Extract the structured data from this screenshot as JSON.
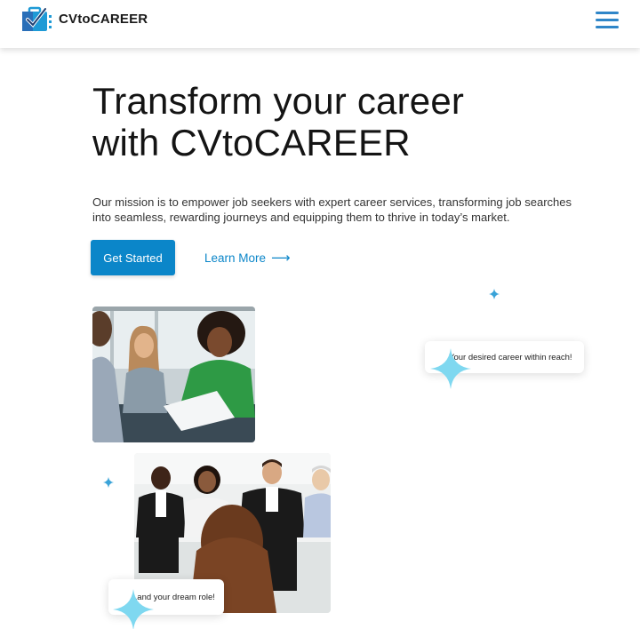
{
  "header": {
    "brand": "CVtoCAREER",
    "logo_icon": "briefcase-check-icon",
    "menu_icon": "hamburger-menu-icon"
  },
  "hero": {
    "title_line1": "Transform your career",
    "title_line2": "with CVtoCAREER",
    "mission": "Our mission is to empower job seekers with expert career services, transforming job searches into seamless, rewarding journeys and equipping them to thrive in today’s market.",
    "cta_primary": "Get Started",
    "cta_secondary": "Learn More",
    "cta_secondary_icon": "arrow-right-icon"
  },
  "callouts": {
    "top": "Your desired career within reach!",
    "bottom": "Land your dream role!"
  },
  "images": {
    "first": "interview-meeting-photo",
    "second": "interview-panel-photo"
  },
  "colors": {
    "accent": "#0b86c9",
    "sparkle": "#7fd8f0",
    "menu": "#2f86c8"
  }
}
